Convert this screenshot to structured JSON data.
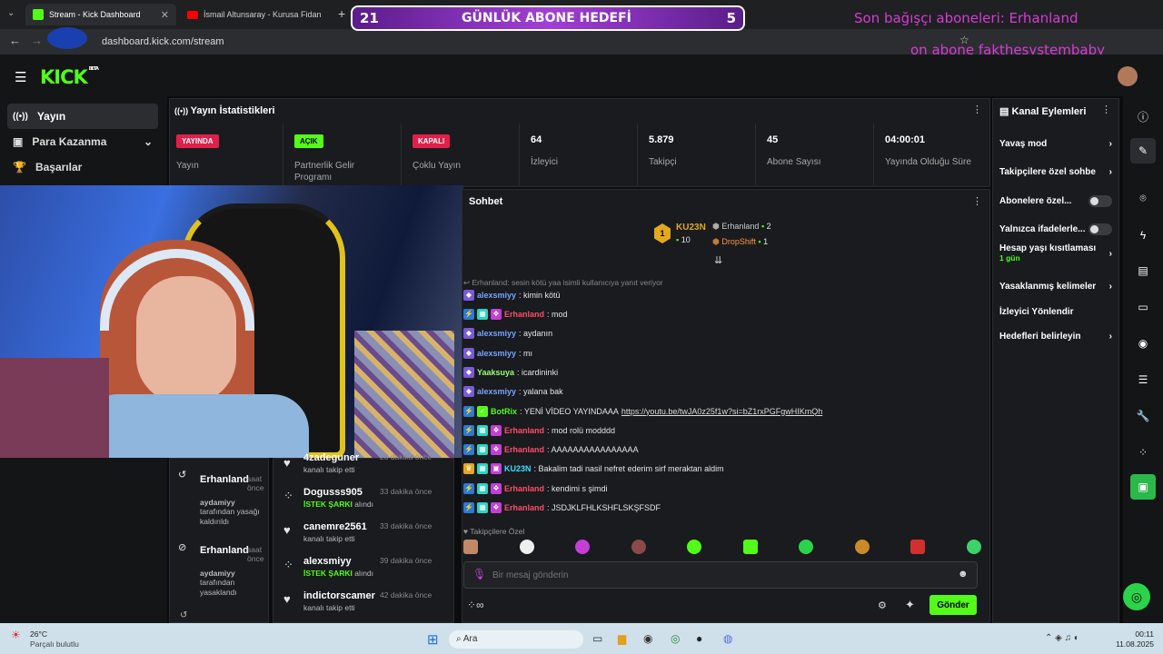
{
  "browser": {
    "tabs": [
      {
        "label": "Stream - Kick Dashboard"
      },
      {
        "label": "İsmail Altunsaray - Kurusa Fidanın"
      }
    ],
    "url": "dashboard.kick.com/stream"
  },
  "overlay": {
    "goal_left": "21",
    "goal_title": "GÜNLÜK ABONE HEDEFİ",
    "goal_right": "5",
    "last_donor": "Son bağışçı aboneleri: Erhanland",
    "last_sub": "on abone  fakthesystembaby"
  },
  "sidebar": {
    "items": [
      {
        "label": "Yayın"
      },
      {
        "label": "Para Kazanma"
      },
      {
        "label": "Başarılar"
      }
    ]
  },
  "stats": {
    "title": "Yayın İstatistikleri",
    "cells": [
      {
        "badge": "YAYINDA",
        "label": "Yayın"
      },
      {
        "badge": "AÇIK",
        "label": "Partnerlik Gelir Programı"
      },
      {
        "badge": "KAPALI",
        "label": "Çoklu Yayın"
      },
      {
        "value": "64",
        "label": "İzleyici"
      },
      {
        "value": "5.879",
        "label": "Takipçi"
      },
      {
        "value": "45",
        "label": "Abone Sayısı"
      },
      {
        "value": "04:00:01",
        "label": "Yayında Olduğu Süre"
      }
    ]
  },
  "chat": {
    "title": "Sohbet",
    "leaderboard": [
      {
        "name": "KU23N",
        "count": "10"
      },
      {
        "name": "Erhanland",
        "count": "2"
      },
      {
        "name": "DropShift",
        "count": "1"
      }
    ],
    "reply_note": "Erhanland: sesin kötü yaa isimli kullanıcıya yanıt veriyor",
    "messages": [
      {
        "user": "alexsmiyy",
        "text": ": kimin kötü"
      },
      {
        "user": "Erhanland",
        "text": ": mod"
      },
      {
        "user": "alexsmiyy",
        "text": ": aydanın"
      },
      {
        "user": "alexsmiyy",
        "text": ": mı"
      },
      {
        "user": "Yaaksuya",
        "text": ": icardininki"
      },
      {
        "user": "alexsmiyy",
        "text": ": yalana bak"
      },
      {
        "user": "BotRix",
        "text": ": YENİ VİDEO YAYINDAAA ",
        "link": "https://youtu.be/twJA0z25f1w?si=bZ1rxPGFgwHIKmQh"
      },
      {
        "user": "Erhanland",
        "text": ": mod rolü modddd"
      },
      {
        "user": "Erhanland",
        "text": ": AAAAAAAAAAAAAAAA"
      },
      {
        "user": "KU23N",
        "text": ": Bakalim tadi nasil nefret ederim sirf meraktan aldim"
      },
      {
        "user": "Erhanland",
        "text": ": kendimi s şimdi"
      },
      {
        "user": "Erhanland",
        "text": ": JSDJKLFHLKSHFLSKŞFSDF"
      }
    ],
    "followers_label": "Takipçilere Özel",
    "input_placeholder": "Bir mesaj gönderin",
    "send_label": "Gönder"
  },
  "activity_left": [
    {
      "name": "Erhanland",
      "who": "aydamiyy",
      "text": "tarafından yasağı kaldırıldı",
      "time": "saat önce"
    },
    {
      "name": "Erhanland",
      "who": "aydamiyy",
      "text": "tarafından yasaklandı",
      "time": "saat önce"
    }
  ],
  "activity_right": [
    {
      "name": "4zadeguner",
      "text": "kanalı takip etti",
      "time": "28 dakika önce"
    },
    {
      "name": "Dogusss905",
      "tag": "İSTEK ŞARKI",
      "text": "alındı",
      "time": "33 dakika önce"
    },
    {
      "name": "canemre2561",
      "text": "kanalı takip etti",
      "time": "33 dakika önce"
    },
    {
      "name": "alexsmiyy",
      "tag": "İSTEK ŞARKI",
      "text": "alındı",
      "time": "39 dakika önce"
    },
    {
      "name": "indictorscamer",
      "text": "kanalı takip etti",
      "time": "42 dakika önce"
    }
  ],
  "channel_actions": {
    "title": "Kanal Eylemleri",
    "items": [
      {
        "label": "Yavaş mod"
      },
      {
        "label": "Takipçilere özel sohbe"
      },
      {
        "label": "Abonelere özel..."
      },
      {
        "label": "Yalnızca ifadelerle..."
      },
      {
        "label": "Hesap yaşı kısıtlaması",
        "sub": "1 gün"
      },
      {
        "label": "Yasaklanmış kelimeler"
      },
      {
        "label": "İzleyici Yönlendir"
      },
      {
        "label": "Hedefleri belirleyin"
      }
    ]
  },
  "taskbar": {
    "weather_temp": "26°C",
    "weather_desc": "Parçalı bulutlu",
    "search": "Ara",
    "time": "00:11",
    "date": "11.08.2025"
  }
}
